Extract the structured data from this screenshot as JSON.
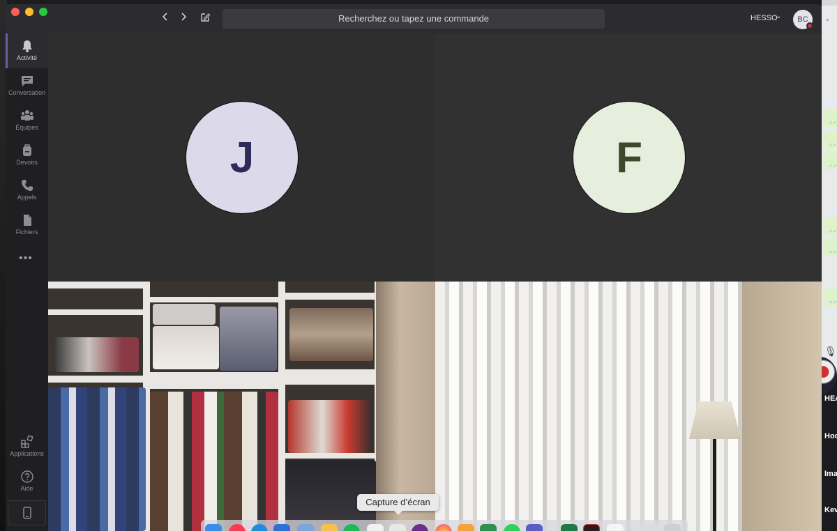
{
  "window": {
    "search_placeholder": "Recherchez ou tapez une commande",
    "org_name": "HESSO",
    "user_initials": "BC"
  },
  "rail": {
    "items": [
      {
        "label": "Activité",
        "icon": "bell-icon",
        "active": true
      },
      {
        "label": "Conversation",
        "icon": "chat-icon"
      },
      {
        "label": "Équipes",
        "icon": "teams-icon"
      },
      {
        "label": "Devoirs",
        "icon": "backpack-icon"
      },
      {
        "label": "Appels",
        "icon": "phone-icon"
      },
      {
        "label": "Fichiers",
        "icon": "file-icon"
      }
    ],
    "more": "•••",
    "bottom": [
      {
        "label": "Applications",
        "icon": "apps-icon"
      },
      {
        "label": "Aide",
        "icon": "help-icon"
      }
    ]
  },
  "participants": [
    {
      "initial": "J",
      "bg": "#dcd9ea",
      "fg": "#2e2a5a"
    },
    {
      "initial": "F",
      "bg": "#e6eedd",
      "fg": "#3b4a29"
    }
  ],
  "tooltip": {
    "text": "Capture d’écran"
  },
  "desktop": {
    "chat_names": [
      "HEA",
      "Hoc",
      "Ima",
      "Kev"
    ]
  }
}
